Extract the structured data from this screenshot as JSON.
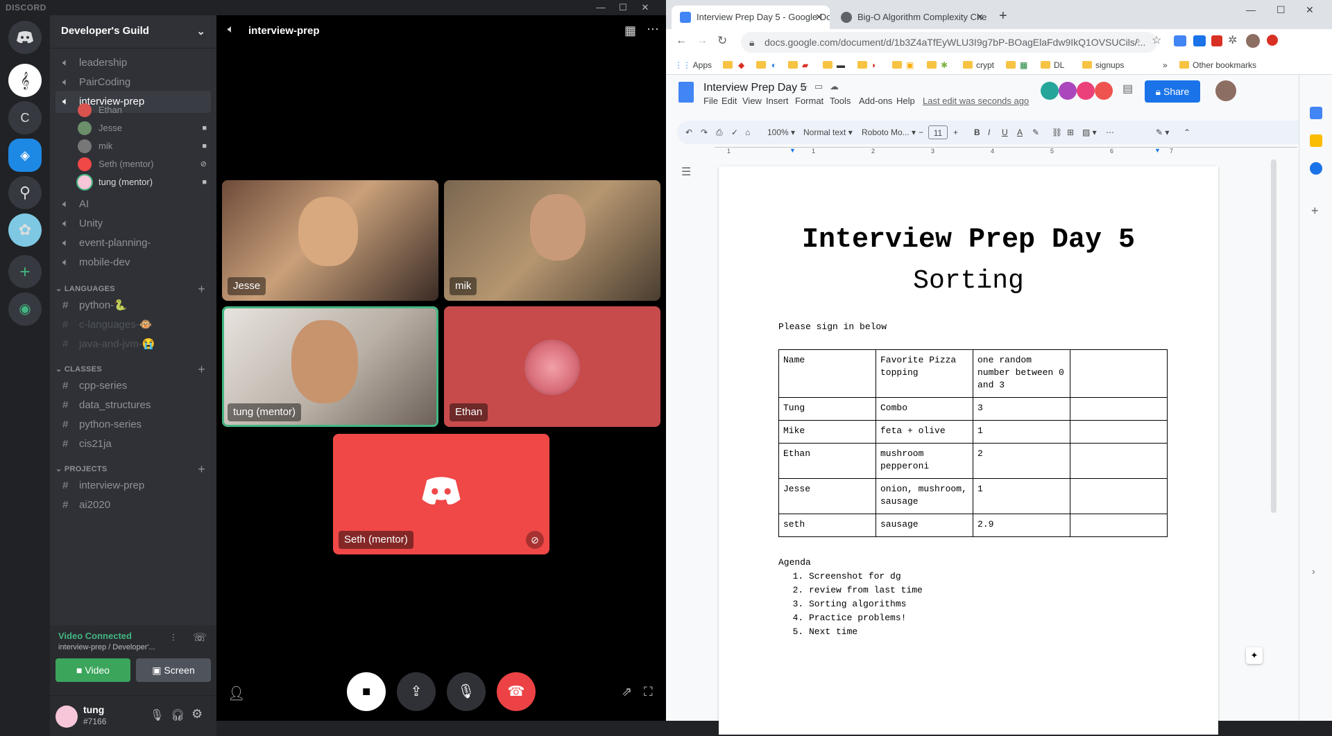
{
  "discord": {
    "brand": "DISCORD",
    "window_controls": {
      "minimize": "—",
      "maximize": "☐",
      "close": "✕"
    },
    "servers": [
      {
        "name": "discord-home",
        "label": "",
        "color": "#36393f"
      },
      {
        "name": "music-server",
        "label": "",
        "color": "#ffffff"
      },
      {
        "name": "c-server",
        "label": "C",
        "color": "#36393f"
      },
      {
        "name": "developers-guild",
        "label": "",
        "color": "#1e88e5"
      },
      {
        "name": "guitar-server",
        "label": "",
        "color": "#36393f"
      },
      {
        "name": "cotton-candy-server",
        "label": "",
        "color": "#7ec8e3"
      },
      {
        "name": "add-server",
        "label": "+",
        "color": "#36393f"
      },
      {
        "name": "explore-servers",
        "label": "",
        "color": "#36393f"
      }
    ],
    "guild_name": "Developer's Guild",
    "channels": [
      {
        "label": "leadership",
        "type": "voice"
      },
      {
        "label": "PairCoding",
        "type": "voice"
      },
      {
        "label": "interview-prep",
        "type": "voice",
        "selected": true
      }
    ],
    "voice_users": [
      {
        "label": "Ethan",
        "color": "#d9534f",
        "status": ""
      },
      {
        "label": "Jesse",
        "color": "#6b8e6b",
        "status": "■◂"
      },
      {
        "label": "mik",
        "color": "#777",
        "status": "■◂"
      },
      {
        "label": "Seth (mentor)",
        "color": "#f04747",
        "status": "⊘"
      },
      {
        "label": "tung (mentor)",
        "color": "#f7c6d9",
        "status": "■◂",
        "speaking": true
      }
    ],
    "channels_more": [
      {
        "label": "AI"
      },
      {
        "label": "Unity"
      },
      {
        "label": "event-planning-"
      },
      {
        "label": "mobile-dev"
      }
    ],
    "categories": {
      "languages": "LANGUAGES",
      "classes": "CLASSES",
      "projects": "PROJECTS"
    },
    "language_channels": [
      {
        "label": "python-",
        "emoji": "🐍",
        "muted": false
      },
      {
        "label": "c-languages-",
        "emoji": "🐵",
        "muted": true
      },
      {
        "label": "java-and-jvm-",
        "emoji": "😭",
        "muted": true
      }
    ],
    "class_channels": [
      {
        "label": "cpp-series"
      },
      {
        "label": "data_structures"
      },
      {
        "label": "python-series"
      },
      {
        "label": "cis21ja"
      }
    ],
    "project_channels": [
      {
        "label": "interview-prep"
      },
      {
        "label": "ai2020"
      }
    ],
    "voice_connected": {
      "title": "Video Connected",
      "subtitle": "interview-prep / Developer'...",
      "video_label": "Video",
      "screen_label": "Screen"
    },
    "user": {
      "name": "tung",
      "tag": "#7166"
    },
    "stage": {
      "channel": "interview-prep",
      "tiles": [
        {
          "name": "Jesse"
        },
        {
          "name": "mik"
        },
        {
          "name": "tung (mentor)"
        },
        {
          "name": "Ethan"
        },
        {
          "name": "Seth (mentor)"
        }
      ]
    }
  },
  "chrome": {
    "tabs": [
      {
        "title": "Interview Prep Day 5 - Google Docs",
        "active": true
      },
      {
        "title": "Big-O Algorithm Complexity Che",
        "active": false
      }
    ],
    "new_tab": "+",
    "url": "docs.google.com/document/d/1b3Z4aTfEyWLU3I9g7bP-BOagElaFdw9IkQ1OVSUCils/...",
    "bookmarks": {
      "apps": "Apps",
      "crypt": "crypt",
      "dl": "DL",
      "signups": "signups",
      "more": "»",
      "other": "Other bookmarks"
    }
  },
  "docs": {
    "title": "Interview Prep Day 5",
    "menu": [
      "File",
      "Edit",
      "View",
      "Insert",
      "Format",
      "Tools",
      "Add-ons",
      "Help"
    ],
    "last_edit": "Last edit was seconds ago",
    "share_label": "Share",
    "zoom": "100%",
    "style": "Normal text",
    "font": "Roboto Mo...",
    "font_size": "11",
    "ruler_numbers": [
      "1",
      "1",
      "2",
      "3",
      "4",
      "5",
      "6",
      "7"
    ],
    "heading": "Interview Prep Day 5",
    "subheading": "Sorting",
    "intro": "Please sign in below",
    "table": {
      "headers": [
        "Name",
        "Favorite Pizza topping",
        "one random number between 0 and 3",
        ""
      ],
      "rows": [
        [
          "Tung",
          "Combo",
          "3",
          ""
        ],
        [
          "Mike",
          "feta + olive",
          "1",
          ""
        ],
        [
          "Ethan",
          "mushroom pepperoni",
          "2",
          ""
        ],
        [
          "Jesse",
          "onion, mushroom, sausage",
          "1",
          ""
        ],
        [
          "seth",
          "sausage",
          "2.9",
          ""
        ]
      ]
    },
    "agenda_title": "Agenda",
    "agenda": [
      "Screenshot for dg",
      "review from last time",
      "Sorting algorithms",
      "Practice problems!",
      "Next time"
    ]
  }
}
